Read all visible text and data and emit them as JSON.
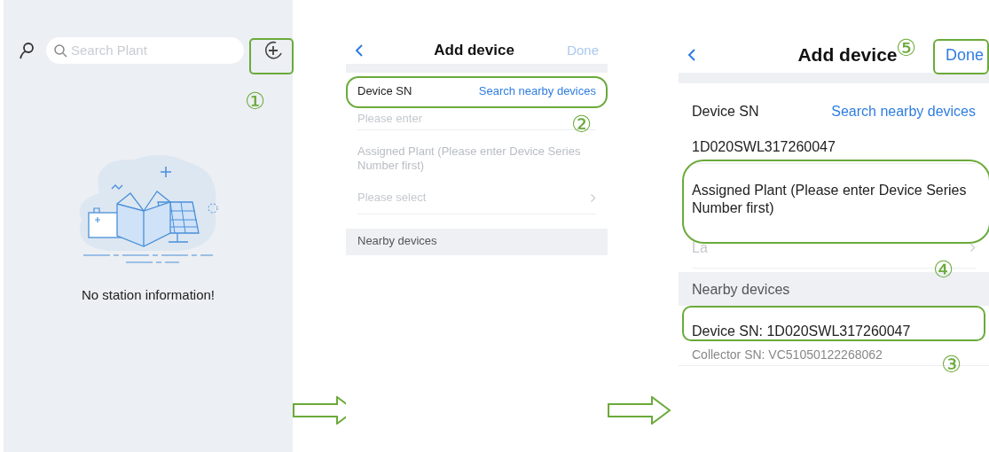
{
  "screens": [
    {
      "kind": "plant_list",
      "search": {
        "placeholder": "Search Plant"
      },
      "empty_message": "No station information!",
      "steps": [
        "①"
      ]
    },
    {
      "kind": "add_device",
      "title": "Add device",
      "done": {
        "label": "Done",
        "disabled": true
      },
      "device_sn": {
        "label": "Device SN",
        "link": "Search nearby devices",
        "placeholder": "Please enter"
      },
      "assigned_plant": {
        "label": "Assigned Plant (Please enter Device Series Number first)",
        "disabled": true,
        "placeholder": "Please select"
      },
      "nearby_section": "Nearby devices",
      "steps": [
        "②"
      ]
    },
    {
      "kind": "add_device",
      "title": "Add device",
      "done": {
        "label": "Done",
        "disabled": false
      },
      "device_sn": {
        "label": "Device SN",
        "link": "Search nearby devices",
        "value": "1D020SWL317260047"
      },
      "assigned_plant": {
        "label": "Assigned Plant (Please enter Device Series Number first)",
        "disabled": false,
        "placeholder": "La"
      },
      "nearby_section": "Nearby devices",
      "devices": [
        {
          "device_sn": "Device SN: 1D020SWL317260047",
          "collector_sn": "Collector SN: VC51050122268062"
        }
      ],
      "steps": [
        "③",
        "④",
        "⑤"
      ]
    }
  ]
}
